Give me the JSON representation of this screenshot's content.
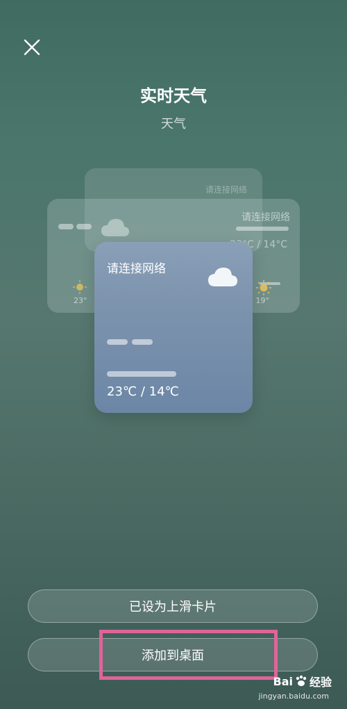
{
  "header": {
    "title": "实时天气",
    "subtitle": "天气"
  },
  "cards": {
    "back_text": "请连接网络",
    "mid": {
      "title": "请连接网络",
      "temp": "23°C / 14°C",
      "left_temp": "23°",
      "right_temp": "19°"
    },
    "front": {
      "title": "请连接网络",
      "temp": "23℃ / 14℃"
    }
  },
  "buttons": {
    "set_swipe": "已设为上滑卡片",
    "add_desktop": "添加到桌面"
  },
  "watermark": {
    "brand_a": "Bai",
    "brand_b": "经验",
    "url": "jingyan.baidu.com"
  },
  "colors": {
    "highlight": "#e0649a",
    "card": "#7d94ae",
    "background": "#4a766b"
  }
}
